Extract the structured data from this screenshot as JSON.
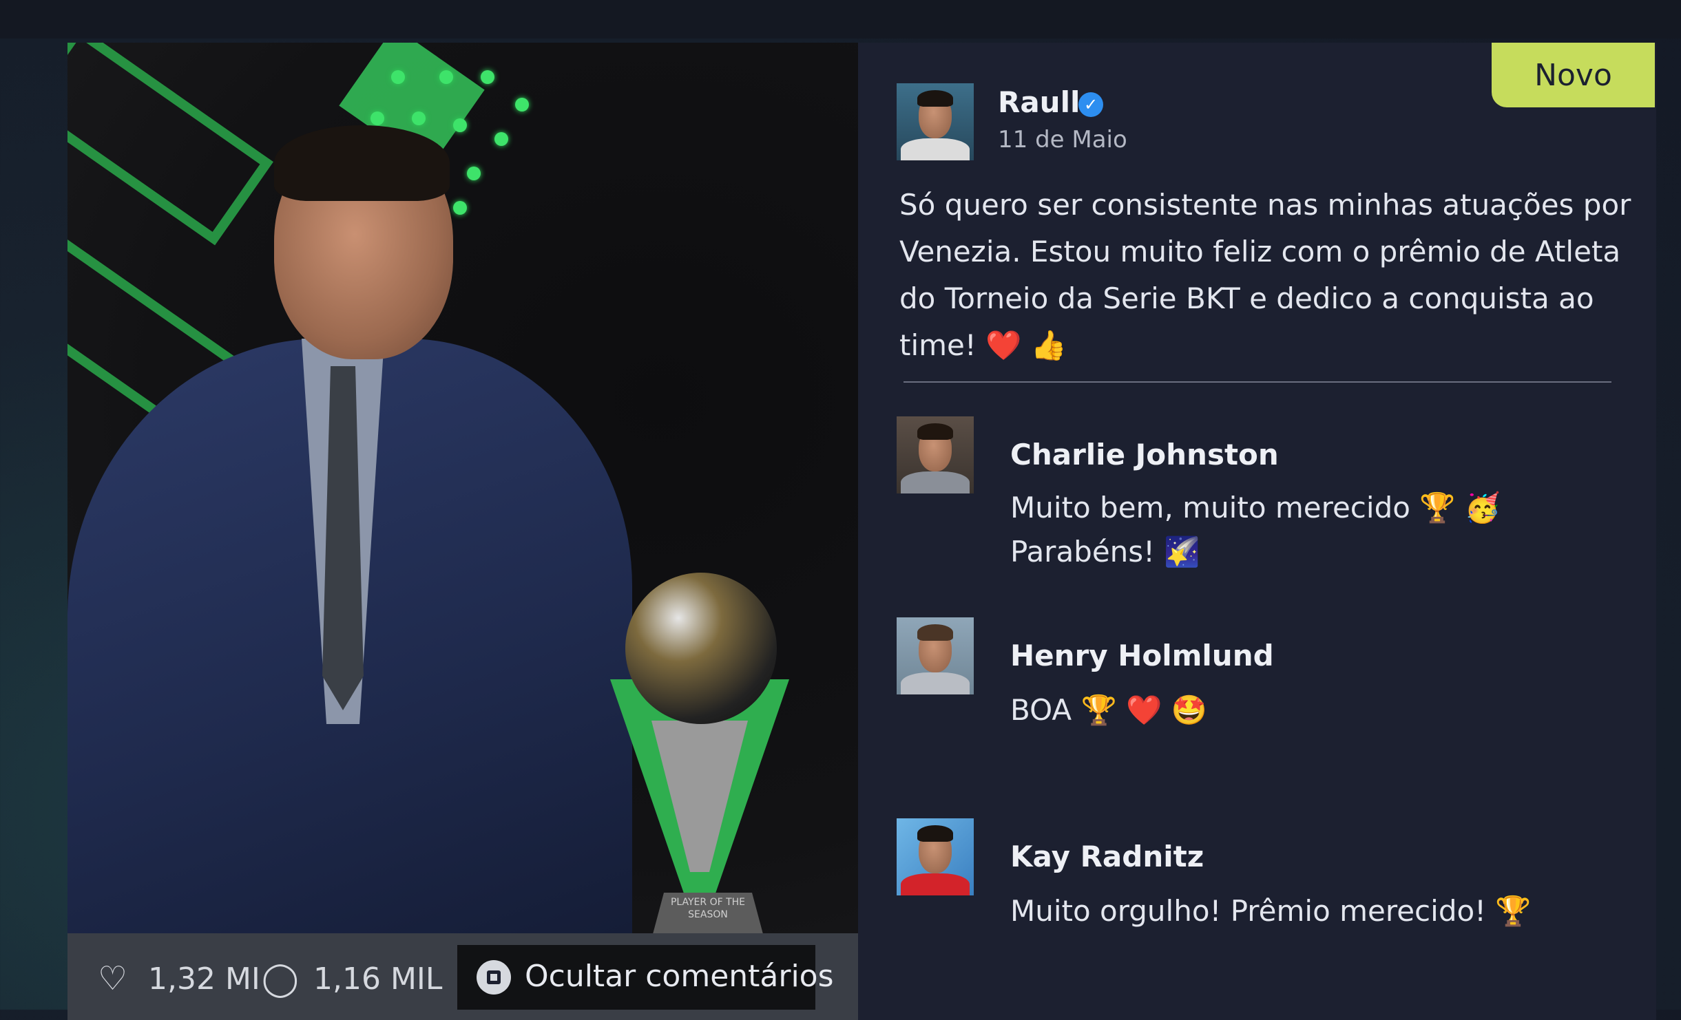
{
  "post": {
    "badge": "Novo",
    "author": "Raull",
    "verified_glyph": "✓",
    "date": "11 de Maio",
    "text": "Só quero ser consistente nas minhas atuações por Venezia. Estou muito feliz com o prêmio de Atleta do Torneio da Serie BKT e dedico a conquista ao time! ❤️ 👍",
    "likes": "1,32 MI",
    "comments_count": "1,16 MIL",
    "hide_comments_label": "Ocultar comentários",
    "trophy_label": "PLAYER OF THE SEASON"
  },
  "comments": [
    {
      "name": "Charlie Johnston",
      "text": "Muito bem, muito merecido 🏆 🥳 Parabéns! 🌠"
    },
    {
      "name": "Henry Holmlund",
      "text": "BOA 🏆 ❤️ 🤩"
    },
    {
      "name": "Kay Radnitz",
      "text": "Muito orgulho! Prêmio merecido! 🏆"
    }
  ],
  "icons": {
    "like": "heart-icon",
    "comment": "comment-bubble-icon",
    "hide": "square-button-icon"
  },
  "colors": {
    "badge": "#c6dc5c",
    "verified": "#2d8ef0",
    "card": "#1c2030",
    "accent_green": "#2fae4f"
  }
}
